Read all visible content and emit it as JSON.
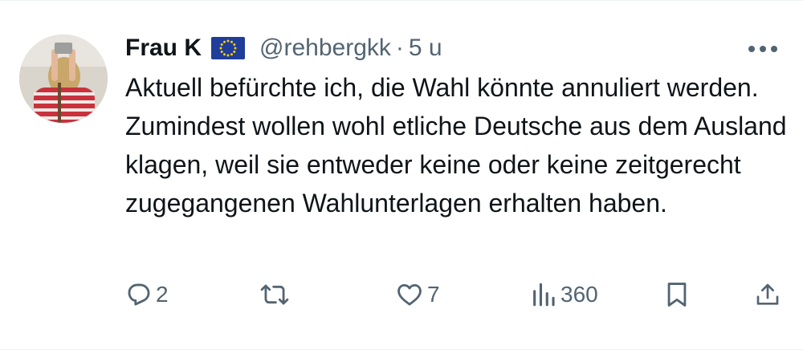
{
  "tweet": {
    "display_name": "Frau K",
    "flag": "eu-flag-icon",
    "handle": "@rehbergkk",
    "separator": "·",
    "timestamp": "5 u",
    "text": "Aktuell befürchte ich, die Wahl könnte annuliert werden. Zumindest wollen wohl etliche Deutsche aus dem Ausland klagen, weil sie entweder keine oder keine zeitgerecht zugegangenen Wahlunterlagen erhalten haben."
  },
  "actions": {
    "reply": {
      "icon": "reply-icon",
      "count": "2"
    },
    "repost": {
      "icon": "repost-icon",
      "count": ""
    },
    "like": {
      "icon": "heart-icon",
      "count": "7"
    },
    "views": {
      "icon": "views-icon",
      "count": "360"
    },
    "bookmark": {
      "icon": "bookmark-icon"
    },
    "share": {
      "icon": "share-icon"
    }
  },
  "colors": {
    "text": "#0f1419",
    "secondary": "#536471",
    "divider": "#eff3f4",
    "eu_blue": "#1f3d99",
    "eu_star": "#ffcc00"
  }
}
